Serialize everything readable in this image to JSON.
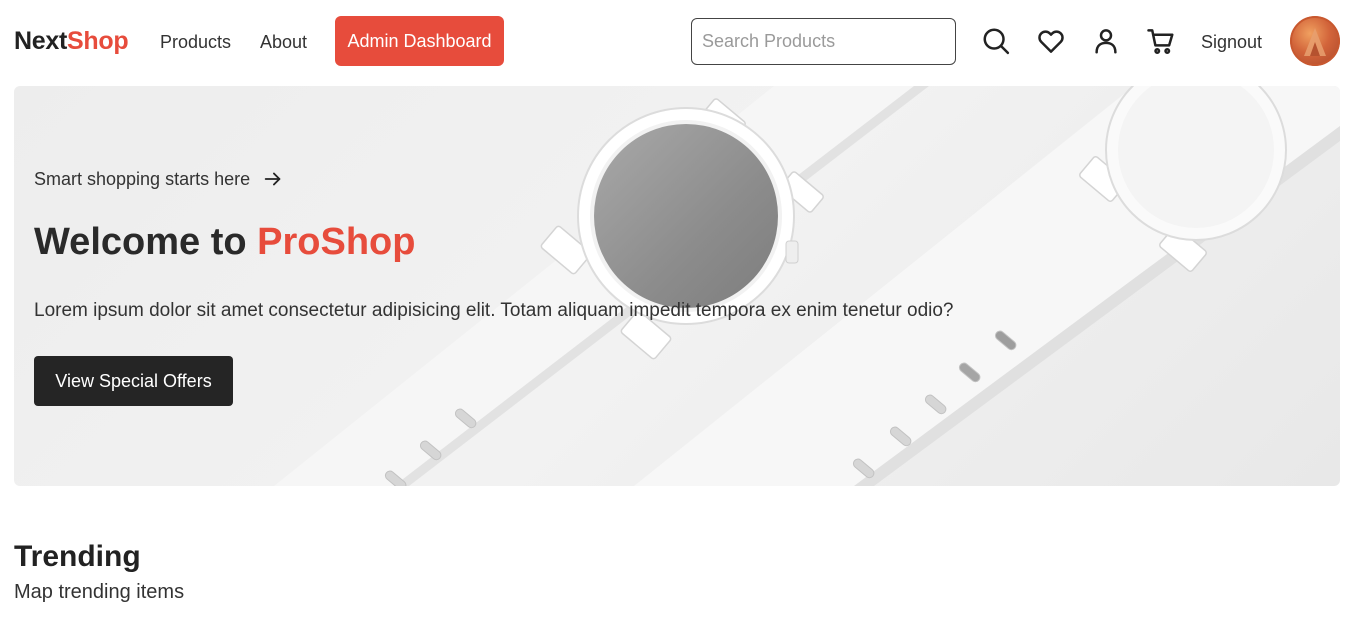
{
  "header": {
    "logo": {
      "part1": "Next",
      "part2": "Shop"
    },
    "nav": {
      "products": "Products",
      "about": "About"
    },
    "admin_button": "Admin Dashboard",
    "search": {
      "placeholder": "Search Products",
      "value": ""
    },
    "icons": [
      "search-icon",
      "heart-icon",
      "user-icon",
      "cart-icon"
    ],
    "signout": "Signout",
    "avatar": "user-avatar"
  },
  "hero": {
    "tagline": "Smart shopping starts here",
    "title_prefix": "Welcome to ",
    "title_accent": "ProShop",
    "description": "Lorem ipsum dolor sit amet consectetur adipisicing elit. Totam aliquam impedit tempora ex enim tenetur odio?",
    "cta": "View Special Offers",
    "image": "smartwatch-banner"
  },
  "trending": {
    "title": "Trending",
    "subtitle": "Map trending items"
  },
  "colors": {
    "accent": "#e74c3c",
    "dark": "#252525",
    "hero_bg": "#ededed"
  }
}
